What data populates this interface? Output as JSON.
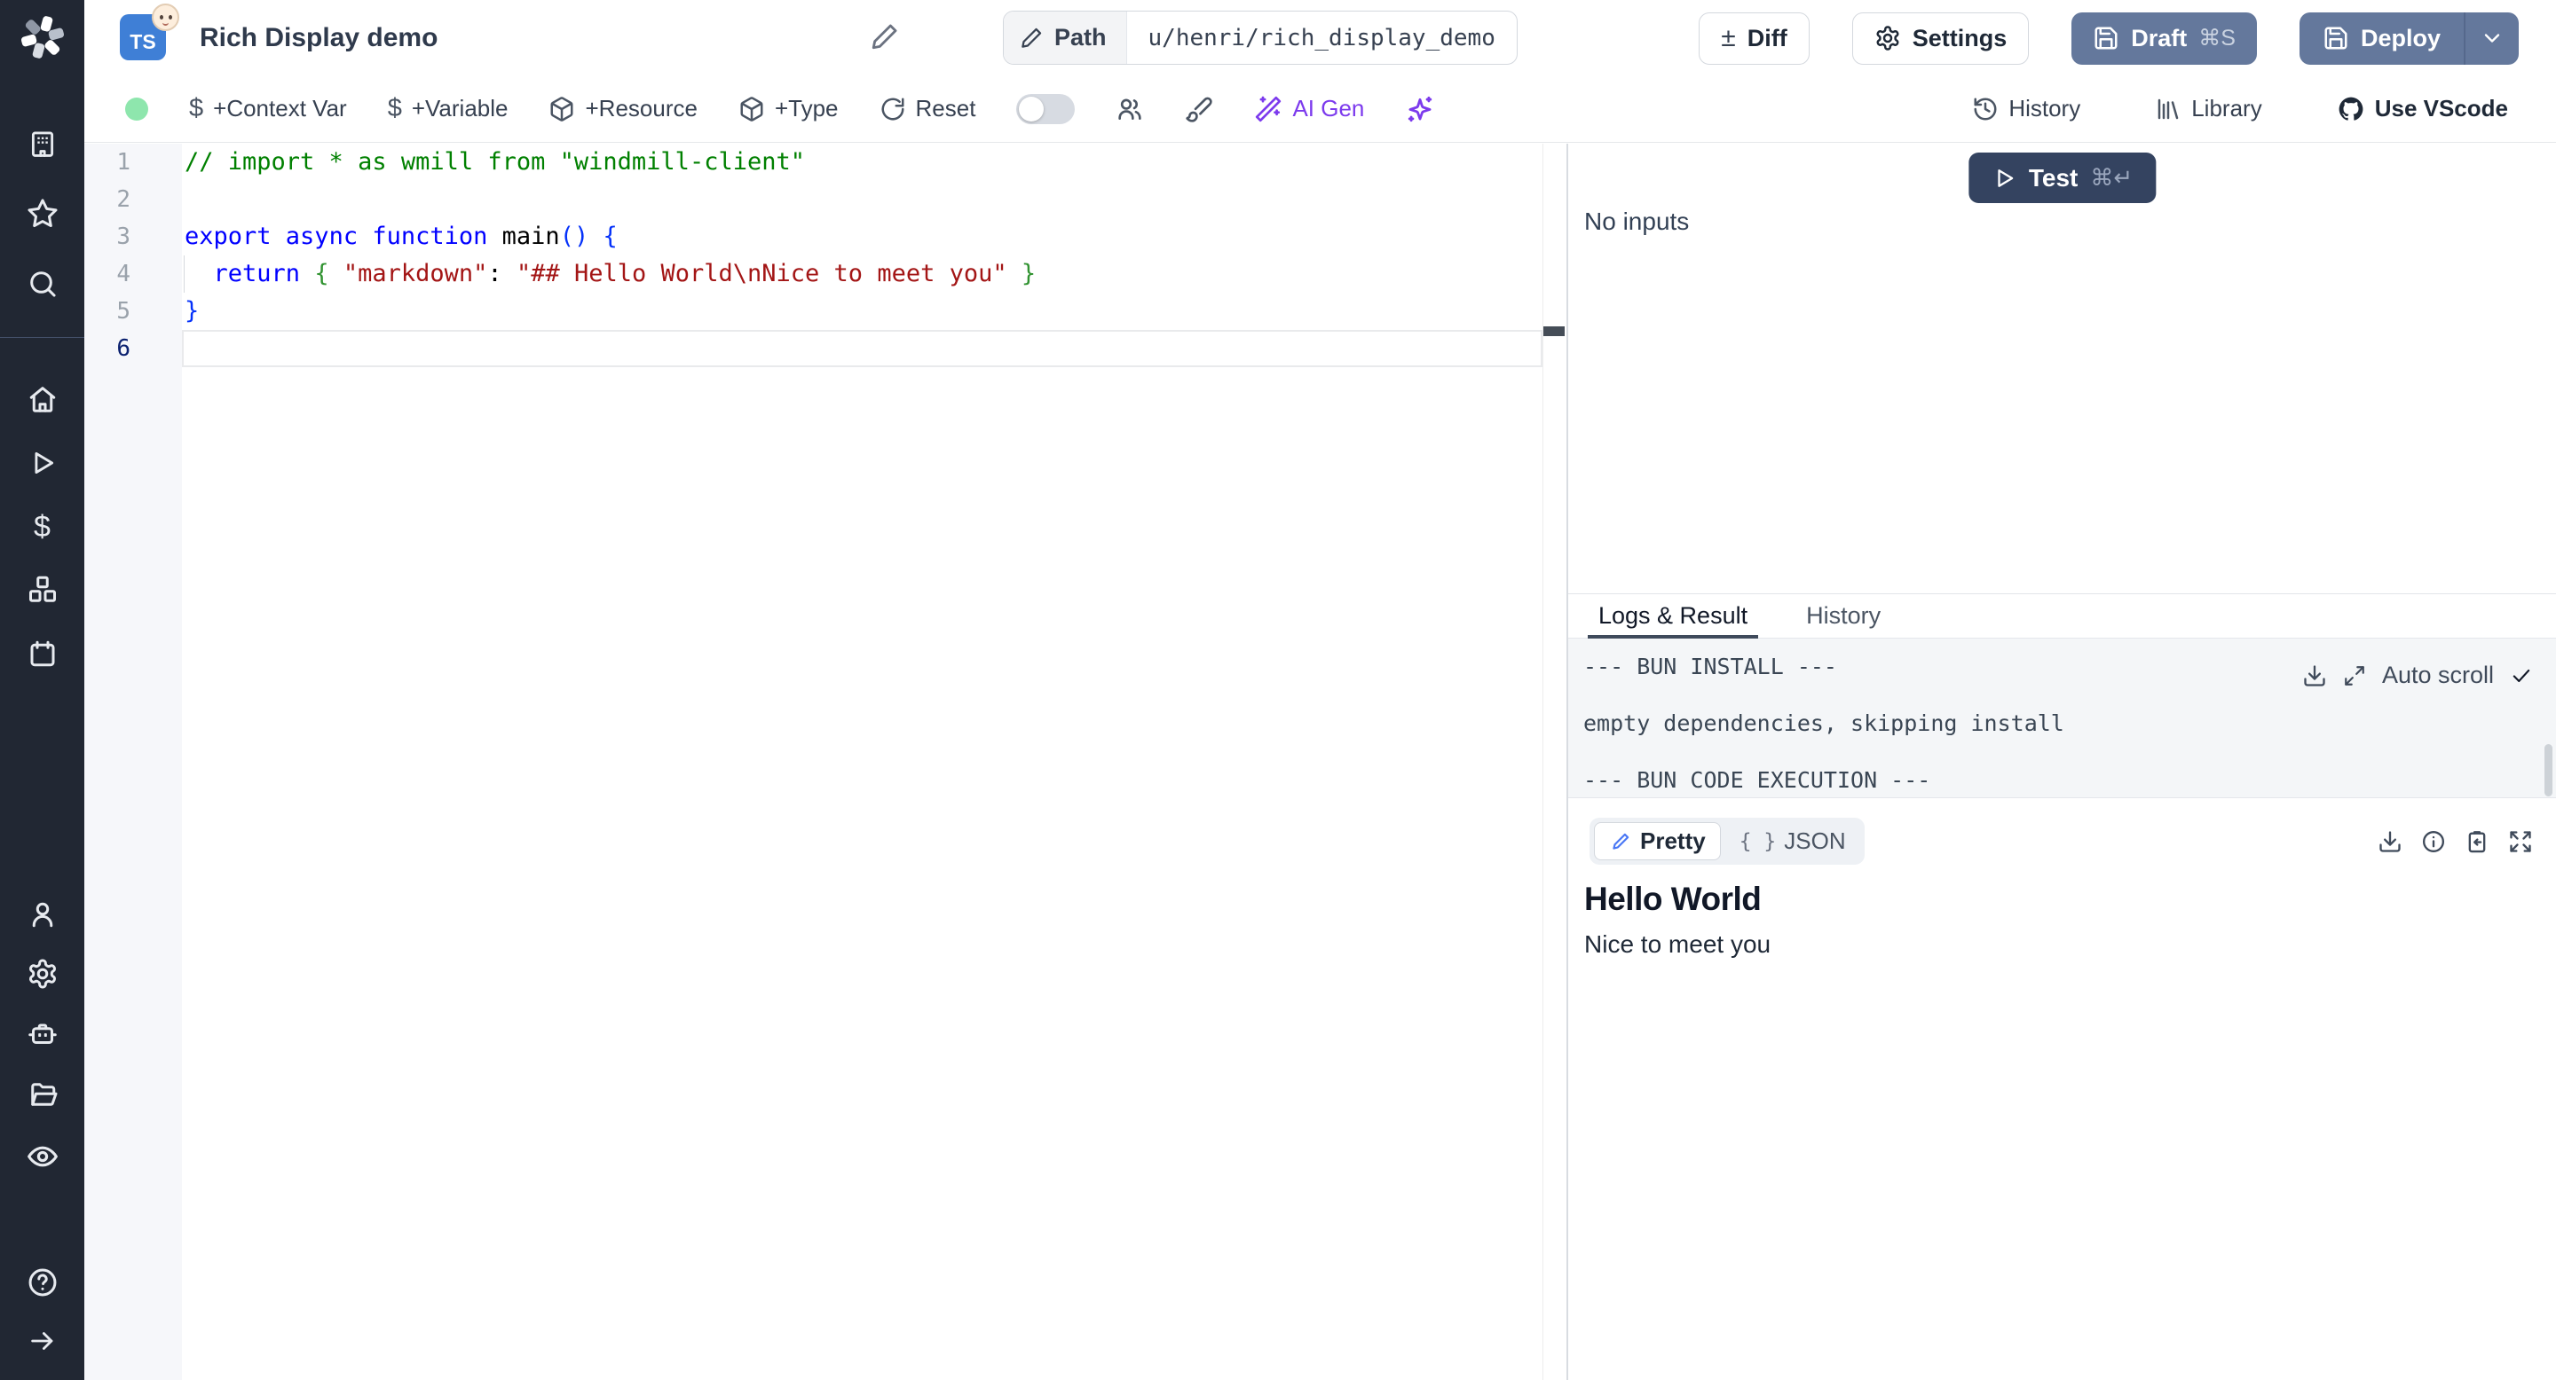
{
  "app": {
    "title": "Rich Display demo",
    "language_badge": "TS"
  },
  "topbar": {
    "path_label": "Path",
    "path_value": "u/henri/rich_display_demo",
    "diff_label": "Diff",
    "settings_label": "Settings",
    "draft_label": "Draft",
    "draft_shortcut": "⌘S",
    "deploy_label": "Deploy"
  },
  "toolbar": {
    "context_var_label": "+Context Var",
    "variable_label": "+Variable",
    "resource_label": "+Resource",
    "type_label": "+Type",
    "reset_label": "Reset",
    "ai_gen_label": "AI Gen",
    "history_label": "History",
    "library_label": "Library",
    "vscode_label": "Use VScode"
  },
  "sidebar": {
    "icons": [
      "windmill-logo",
      "buildings",
      "star",
      "search",
      "home",
      "play-runs",
      "dollar-variables",
      "cubes-resources",
      "calendar-schedules",
      "user",
      "gear-settings",
      "robot-workers",
      "folder",
      "eye-audit",
      "help-circle",
      "arrow-right-expand"
    ]
  },
  "editor": {
    "lines": [
      {
        "num": 1,
        "tokens": [
          {
            "t": "// import * as wmill from \"windmill-client\"",
            "c": "comment"
          }
        ]
      },
      {
        "num": 2,
        "tokens": []
      },
      {
        "num": 3,
        "tokens": [
          {
            "t": "export ",
            "c": "kw"
          },
          {
            "t": "async ",
            "c": "kw"
          },
          {
            "t": "function ",
            "c": "kw"
          },
          {
            "t": "main",
            "c": "fn"
          },
          {
            "t": "()",
            "c": "b1"
          },
          {
            "t": " ",
            "c": "plain"
          },
          {
            "t": "{",
            "c": "b1"
          }
        ]
      },
      {
        "num": 4,
        "tokens": [
          {
            "t": "  ",
            "c": "plain"
          },
          {
            "t": "return",
            "c": "kw"
          },
          {
            "t": " ",
            "c": "plain"
          },
          {
            "t": "{",
            "c": "b2"
          },
          {
            "t": " ",
            "c": "plain"
          },
          {
            "t": "\"markdown\"",
            "c": "str"
          },
          {
            "t": ": ",
            "c": "plain"
          },
          {
            "t": "\"## Hello World\\nNice to meet you\"",
            "c": "str"
          },
          {
            "t": " ",
            "c": "plain"
          },
          {
            "t": "}",
            "c": "b2"
          }
        ]
      },
      {
        "num": 5,
        "tokens": [
          {
            "t": "}",
            "c": "b1"
          }
        ]
      },
      {
        "num": 6,
        "tokens": [],
        "current": true
      }
    ]
  },
  "run_panel": {
    "test_label": "Test",
    "test_shortcut": "⌘↵",
    "no_inputs": "No inputs"
  },
  "results": {
    "tabs": [
      {
        "label": "Logs & Result",
        "active": true
      },
      {
        "label": "History",
        "active": false
      }
    ],
    "auto_scroll_label": "Auto scroll",
    "log_lines": [
      "--- BUN INSTALL ---",
      "empty dependencies, skipping install",
      "--- BUN CODE EXECUTION ---"
    ],
    "view_pretty_label": "Pretty",
    "view_json_label": "JSON",
    "output_heading": "Hello World",
    "output_text": "Nice to meet you"
  },
  "colors": {
    "primary_button": "#64789c",
    "test_button": "#344360",
    "ai_accent": "#7c3aed",
    "status_green": "#8ee6ad",
    "sidebar_bg": "#212733",
    "keyword": "#0000ff",
    "comment": "#008000",
    "string": "#a31515",
    "bracket_level1": "#0431fa",
    "bracket_level2": "#319331",
    "typescript_badge": "#3f7fd6"
  }
}
